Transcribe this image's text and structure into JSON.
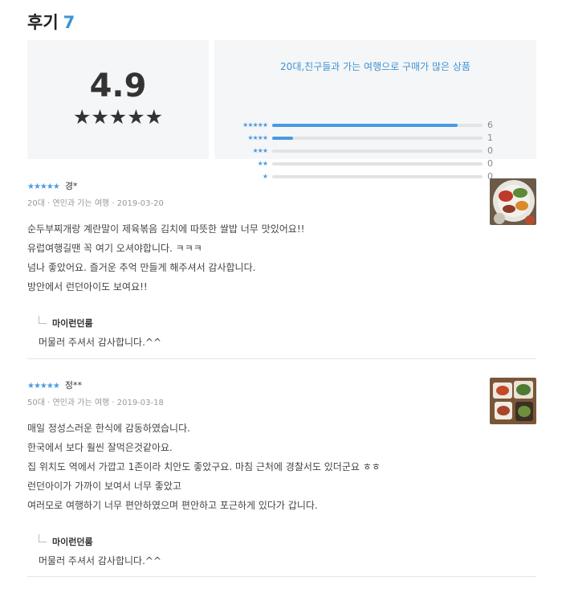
{
  "header": {
    "title": "후기",
    "count": "7"
  },
  "summary": {
    "average": "4.9",
    "average_stars": "★★★★★",
    "distribution_title": "20대,친구들과 가는 여행으로 구매가 많은 상품",
    "rows": [
      {
        "stars": "★★★★★",
        "count": "6",
        "fill": 0.88
      },
      {
        "stars": "★★★★",
        "count": "1",
        "fill": 0.1
      },
      {
        "stars": "★★★",
        "count": "0",
        "fill": 0
      },
      {
        "stars": "★★",
        "count": "0",
        "fill": 0
      },
      {
        "stars": "★",
        "count": "0",
        "fill": 0
      }
    ]
  },
  "reviews": [
    {
      "stars": "★★★★★",
      "name": "경*",
      "meta": "20대 · 연인과 가는 여행 · 2019-03-20",
      "lines": [
        "순두부찌개랑 계란말이 제육볶음 김치에 따뜻한 쌀밥 너무 맛있어요!!",
        "유럽여행길땐 꼭 여기 오셔야합니다. ㅋㅋㅋ",
        "넘나 좋았어요. 즐거운 추억 만들게 해주셔서 감사합니다.",
        "방안에서 런던아이도 보여요!!"
      ],
      "reply_author": "마이런던룸",
      "reply_text": "머물러 주셔서 감사합니다.^^"
    },
    {
      "stars": "★★★★★",
      "name": "정**",
      "meta": "50대 · 연인과 가는 여행 · 2019-03-18",
      "lines": [
        "매일 정성스러운 한식에 감동하였습니다.",
        "한국에서 보다 훨씬 잘먹은것같아요.",
        "집 위치도 역에서 가깝고 1존이라 치안도 좋았구요. 마침 근처에 경찰서도 있더군요 ㅎㅎ",
        "런던아이가 가까이 보여서 너무 좋았고",
        "여러모로 여행하기 너무 편안하였으며 편안하고 포근하게 있다가 갑니다."
      ],
      "reply_author": "마이런던룸",
      "reply_text": "머물러 주셔서 감사합니다.^^"
    }
  ]
}
